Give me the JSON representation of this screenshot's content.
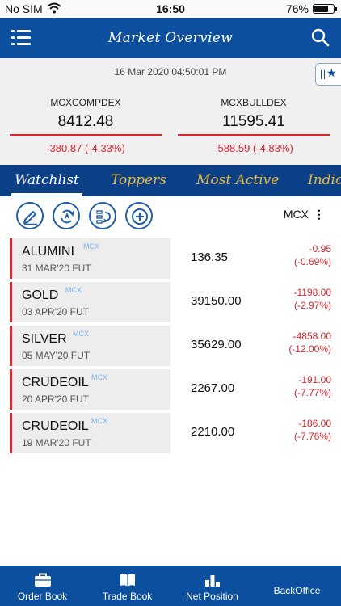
{
  "status_bar": {
    "carrier": "No SIM",
    "time": "16:50",
    "battery": "76%",
    "battery_level": 0.76
  },
  "header": {
    "title": "Market Overview",
    "menu_icon": "hamburger-menu-icon",
    "search_icon": "search-icon"
  },
  "indices": {
    "datetime": "16 Mar 2020 04:50:01 PM",
    "items": [
      {
        "name": "MCXCOMPDEX",
        "value": "8412.48",
        "change": "-380.87 (-4.33%)"
      },
      {
        "name": "MCXBULLDEX",
        "value": "11595.41",
        "change": "-588.59 (-4.83%)"
      }
    ]
  },
  "tabs": [
    {
      "label": "Watchlist",
      "active": true
    },
    {
      "label": "Toppers",
      "active": false
    },
    {
      "label": "Most Active",
      "active": false
    },
    {
      "label": "Indic",
      "active": false
    }
  ],
  "toolbar": {
    "icons": [
      "edit-icon",
      "refresh-sort-icon",
      "reorder-icon",
      "add-icon"
    ],
    "exchange": "MCX"
  },
  "watchlist": [
    {
      "symbol": "ALUMINI",
      "exchange": "MCX",
      "expiry": "31 MAR'20 FUT",
      "ltp": "136.35",
      "change": "-0.95",
      "pct": "(-0.69%)"
    },
    {
      "symbol": "GOLD",
      "exchange": "MCX",
      "expiry": "03 APR'20 FUT",
      "ltp": "39150.00",
      "change": "-1198.00",
      "pct": "(-2.97%)"
    },
    {
      "symbol": "SILVER",
      "exchange": "MCX",
      "expiry": "05 MAY'20 FUT",
      "ltp": "35629.00",
      "change": "-4858.00",
      "pct": "(-12.00%)"
    },
    {
      "symbol": "CRUDEOIL",
      "exchange": "MCX",
      "expiry": "20 APR'20 FUT",
      "ltp": "2267.00",
      "change": "-191.00",
      "pct": "(-7.77%)"
    },
    {
      "symbol": "CRUDEOIL",
      "exchange": "MCX",
      "expiry": "19 MAR'20 FUT",
      "ltp": "2210.00",
      "change": "-186.00",
      "pct": "(-7.76%)"
    }
  ],
  "bottom_nav": [
    {
      "label": "Order Book",
      "icon": "briefcase-icon"
    },
    {
      "label": "Trade Book",
      "icon": "book-icon"
    },
    {
      "label": "Net Position",
      "icon": "bar-chart-icon"
    },
    {
      "label": "BackOffice",
      "icon": ""
    }
  ],
  "colors": {
    "primary": "#0b4f9e",
    "tab_bar": "#0b3f86",
    "tab_inactive": "#e9b93b",
    "negative": "#d9262d",
    "exchange_tag": "#7ab3ea"
  }
}
